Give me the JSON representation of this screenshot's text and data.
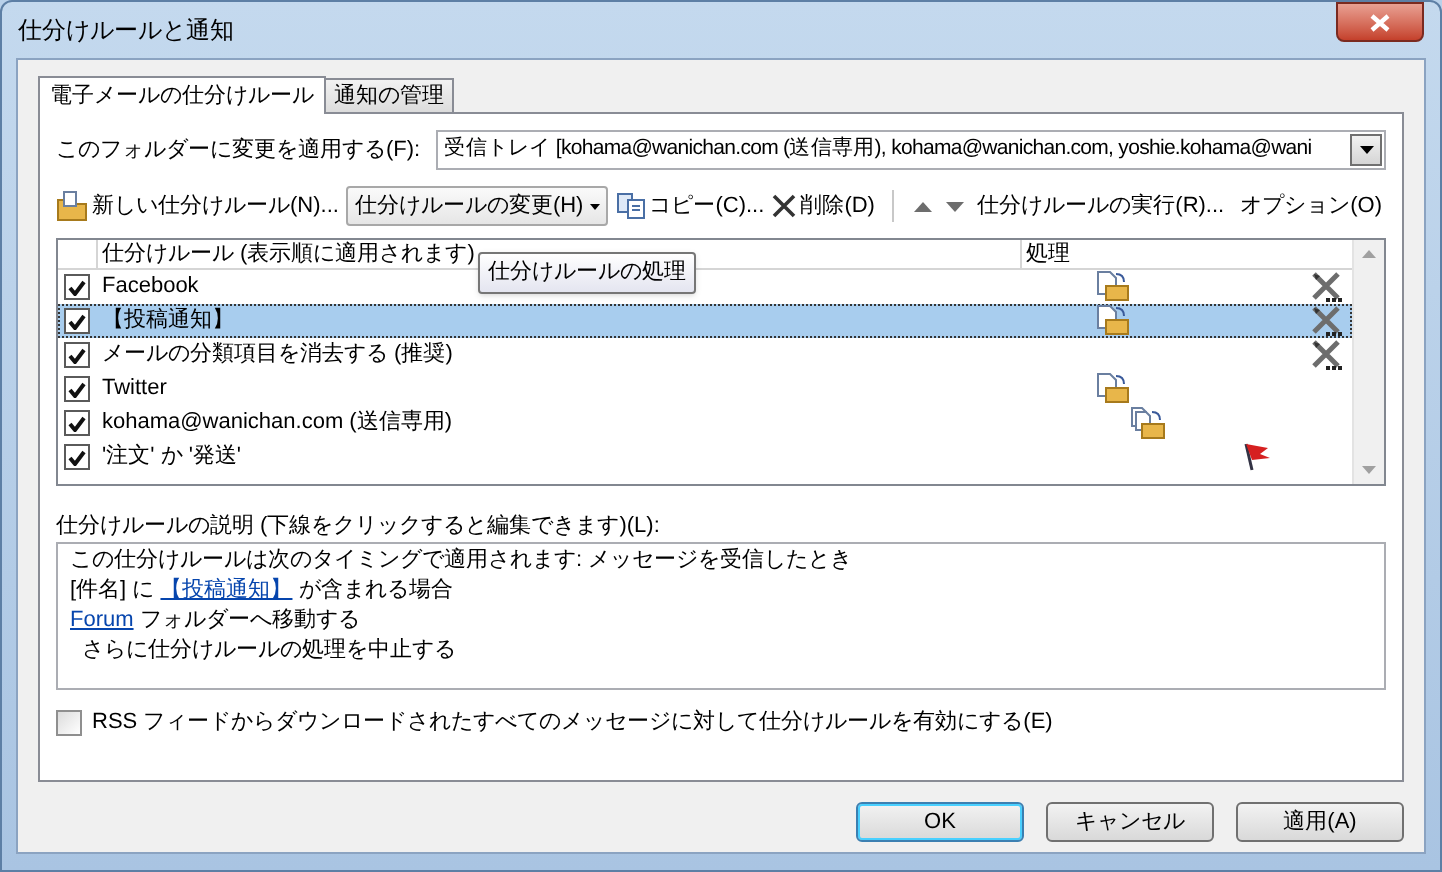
{
  "window": {
    "title": "仕分けルールと通知"
  },
  "tabs": [
    {
      "label": "電子メールの仕分けルール",
      "selected": true
    },
    {
      "label": "通知の管理",
      "selected": false
    }
  ],
  "folder": {
    "label": "このフォルダーに変更を適用する(F):",
    "value": "受信トレイ [kohama@wanichan.com (送信専用), kohama@wanichan.com, yoshie.kohama@wani"
  },
  "toolbar": [
    {
      "kind": "new",
      "label": "新しい仕分けルール(N)..."
    },
    {
      "kind": "dropdown",
      "label": "仕分けルールの変更(H)"
    },
    {
      "kind": "copy",
      "label": "コピー(C)..."
    },
    {
      "kind": "delete",
      "label": "削除(D)"
    },
    {
      "kind": "up"
    },
    {
      "kind": "down"
    },
    {
      "kind": "text",
      "label": "仕分けルールの実行(R)..."
    },
    {
      "kind": "text",
      "label": "オプション(O)"
    }
  ],
  "tooltip": "仕分けルールの処理",
  "rules_list": {
    "columns": [
      "仕分けルール (表示順に適用されます)",
      "処理"
    ],
    "rows": [
      {
        "name": "Facebook",
        "checked": true,
        "selected": false,
        "actions": [
          {
            "kind": "move"
          },
          {
            "kind": "custom"
          }
        ]
      },
      {
        "name": "【投稿通知】",
        "checked": true,
        "selected": true,
        "actions": [
          {
            "kind": "move"
          },
          {
            "kind": "custom"
          }
        ]
      },
      {
        "name": "メールの分類項目を消去する (推奨)",
        "checked": true,
        "selected": false,
        "actions": [
          {
            "kind": "custom"
          }
        ]
      },
      {
        "name": "Twitter",
        "checked": true,
        "selected": false,
        "actions": [
          {
            "kind": "move"
          }
        ]
      },
      {
        "name": "kohama@wanichan.com (送信専用)",
        "checked": true,
        "selected": false,
        "actions": [
          {
            "kind": "copy"
          }
        ]
      },
      {
        "name": "'注文' か '発送'",
        "checked": true,
        "selected": false,
        "actions": [
          {
            "kind": "flag"
          }
        ]
      }
    ]
  },
  "description": {
    "label": "仕分けルールの説明 (下線をクリックすると編集できます)(L):",
    "lines": [
      [
        {
          "text": "この仕分けルールは次のタイミングで適用されます: メッセージを受信したとき",
          "link": false
        }
      ],
      [
        {
          "text": "[件名] に ",
          "link": false
        },
        {
          "text": "【投稿通知】",
          "link": true
        },
        {
          "text": " が含まれる場合",
          "link": false
        }
      ],
      [
        {
          "text": "Forum",
          "link": true
        },
        {
          "text": " フォルダーへ移動する",
          "link": false
        }
      ],
      [
        {
          "text": "  さらに仕分けルールの処理を中止する",
          "link": false
        }
      ]
    ]
  },
  "rss_option": {
    "label": "RSS フィードからダウンロードされたすべてのメッセージに対して仕分けルールを有効にする(E)",
    "checked": false
  },
  "buttons": [
    {
      "label": "OK",
      "default": true
    },
    {
      "label": "キャンセル",
      "default": false
    },
    {
      "label": "適用(A)",
      "default": false
    }
  ]
}
